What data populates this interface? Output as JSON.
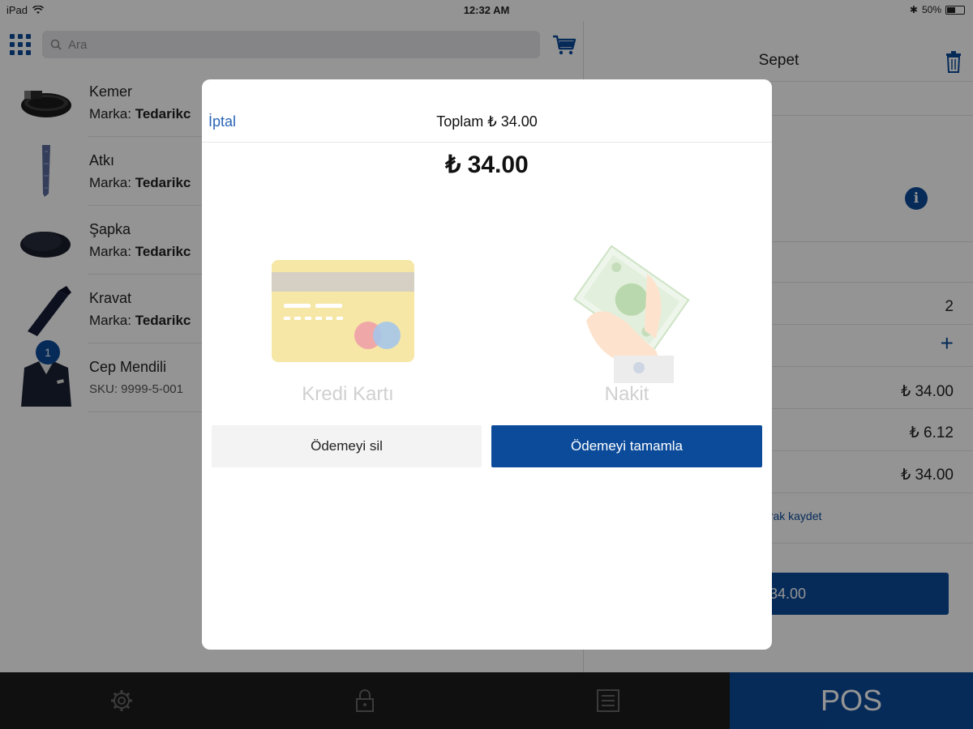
{
  "status_bar": {
    "device": "iPad",
    "time": "12:32 AM",
    "battery": "50%"
  },
  "search": {
    "placeholder": "Ara"
  },
  "products": [
    {
      "name": "Kemer",
      "brand_label": "Marka:",
      "brand": "Tedarikc"
    },
    {
      "name": "Atkı",
      "brand_label": "Marka:",
      "brand": "Tedarikc"
    },
    {
      "name": "Şapka",
      "brand_label": "Marka:",
      "brand": "Tedarikc"
    },
    {
      "name": "Kravat",
      "brand_label": "Marka:",
      "brand": "Tedarikc"
    },
    {
      "name": "Cep Mendili",
      "sku": "SKU: 9999-5-001",
      "badge": "1"
    }
  ],
  "cart": {
    "title": "Sepet",
    "quantity": "2",
    "subtotal": "₺ 34.00",
    "tax": "₺ 6.12",
    "total": "₺ 34.00",
    "save_link": "arak kaydet",
    "pay_button": "34.00"
  },
  "tabbar": {
    "pos_label": "POS"
  },
  "modal": {
    "cancel": "İptal",
    "title": "Toplam ₺ 34.00",
    "amount": "₺ 34.00",
    "credit_card_label": "Kredi Kartı",
    "cash_label": "Nakit",
    "delete_button": "Ödemeyi sil",
    "complete_button": "Ödemeyi tamamla"
  },
  "colors": {
    "brand": "#0b4b9a",
    "link": "#2a64b5",
    "tabbar": "#1c1c1c"
  }
}
